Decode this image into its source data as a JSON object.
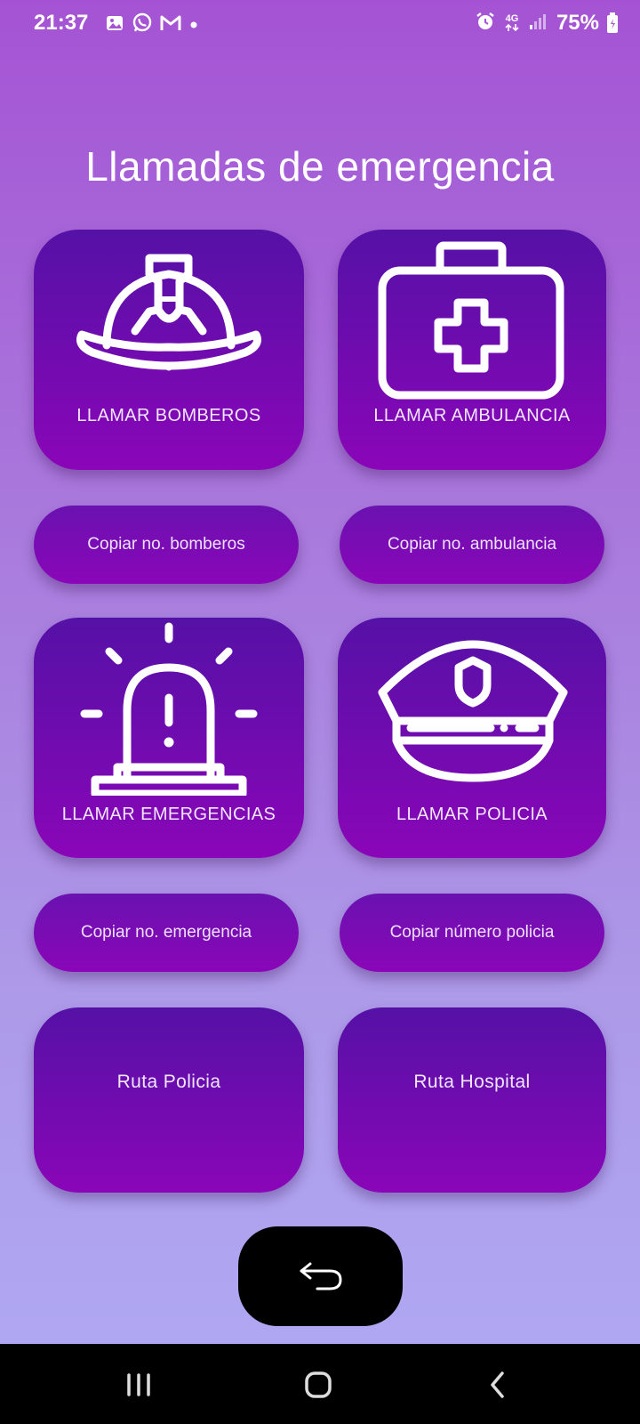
{
  "status_bar": {
    "time": "21:37",
    "notification_icons": [
      "gallery-icon",
      "whatsapp-icon",
      "gmail-icon",
      "dot-icon"
    ],
    "system_icons": [
      "alarm-icon",
      "4g-icon",
      "signal-icon"
    ],
    "network_label": "4G",
    "battery": "75%"
  },
  "page": {
    "title": "Llamadas de emergencia"
  },
  "cards": {
    "firefighters": {
      "label": "LLAMAR BOMBEROS",
      "icon": "firefighter-helmet-icon"
    },
    "ambulance": {
      "label": "LLAMAR AMBULANCIA",
      "icon": "first-aid-kit-icon"
    },
    "emergency": {
      "label": "LLAMAR EMERGENCIAS",
      "icon": "siren-icon"
    },
    "police": {
      "label": "LLAMAR POLICIA",
      "icon": "police-cap-icon"
    }
  },
  "copy_buttons": {
    "firefighters": "Copiar no. bomberos",
    "ambulance": "Copiar no. ambulancia",
    "emergency": "Copiar no. emergencia",
    "police": "Copiar número policia"
  },
  "routes": {
    "police": "Ruta Policia",
    "hospital": "Ruta Hospital"
  },
  "back_button": {
    "icon": "back-arrow-icon"
  },
  "nav_bar": {
    "items": [
      "recents-icon",
      "home-icon",
      "back-icon"
    ]
  },
  "colors": {
    "card_top": "#5511a6",
    "card_bottom": "#8a06b8",
    "background_top": "#a553d4",
    "background_bottom": "#b0aaf5"
  }
}
